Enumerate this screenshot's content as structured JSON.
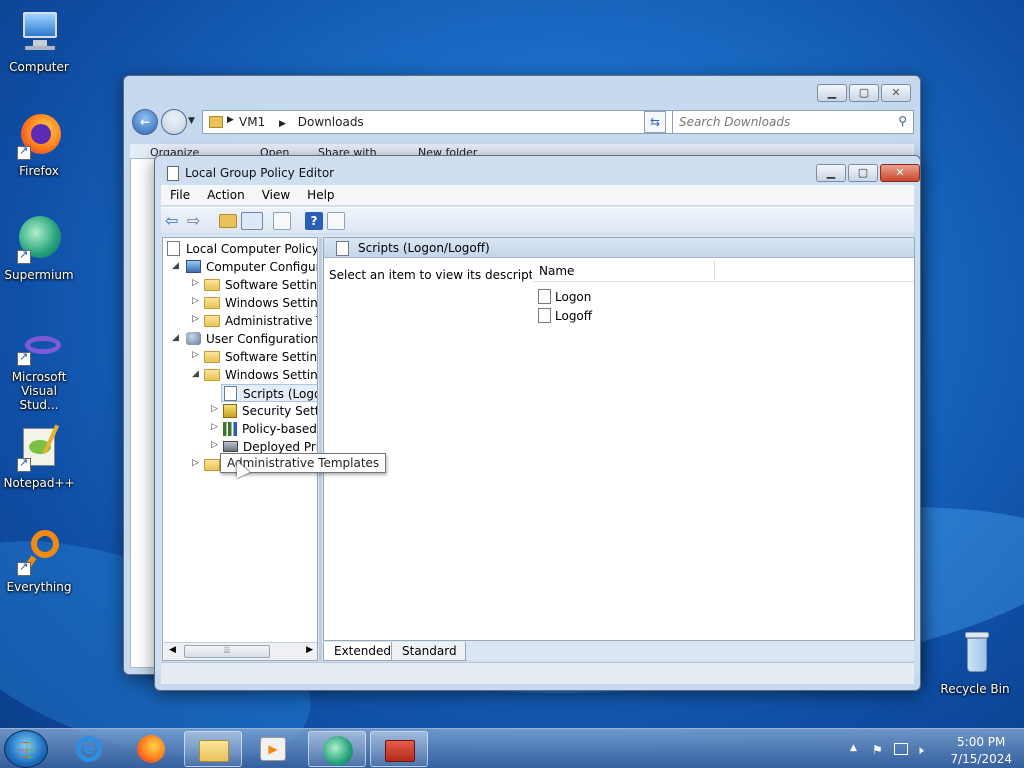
{
  "desktop": {
    "icons": [
      {
        "label": "Computer",
        "icon": "computer-icon"
      },
      {
        "label": "Firefox",
        "icon": "firefox-icon"
      },
      {
        "label": "Supermium",
        "icon": "supermium-icon"
      },
      {
        "label": "Microsoft Visual Stud...",
        "icon": "visual-studio-icon"
      },
      {
        "label": "Notepad++",
        "icon": "notepadpp-icon"
      },
      {
        "label": "Everything",
        "icon": "everything-icon"
      },
      {
        "label": "Recycle Bin",
        "icon": "recycle-bin-icon"
      }
    ]
  },
  "explorer": {
    "breadcrumb": [
      "VM1",
      "Downloads"
    ],
    "search_placeholder": "Search Downloads",
    "toolbar": [
      "Organize",
      "Open",
      "Share with",
      "New folder"
    ]
  },
  "gpedit": {
    "title": "Local Group Policy Editor",
    "menu": [
      "File",
      "Action",
      "View",
      "Help"
    ],
    "tree": [
      {
        "label": "Local Computer Policy",
        "level": 0
      },
      {
        "label": "Computer Configura",
        "level": 1
      },
      {
        "label": "Software Settings",
        "level": 2
      },
      {
        "label": "Windows Setting",
        "level": 2
      },
      {
        "label": "Administrative Te",
        "level": 2
      },
      {
        "label": "User Configuration",
        "level": 1
      },
      {
        "label": "Software Settings",
        "level": 2
      },
      {
        "label": "Windows Setting",
        "level": 2
      },
      {
        "label": "Scripts (Logon",
        "level": 3
      },
      {
        "label": "Security Settir",
        "level": 3
      },
      {
        "label": "Policy-based",
        "level": 3
      },
      {
        "label": "Deployed Prir",
        "level": 3
      },
      {
        "label": "Administrative Templates",
        "level": 2
      }
    ],
    "tooltip": "Administrative Templates",
    "right_header": "Scripts (Logon/Logoff)",
    "description": "Select an item to view its description.",
    "list": {
      "column": "Name",
      "items": [
        "Logon",
        "Logoff"
      ]
    },
    "tabs": [
      "Extended",
      "Standard"
    ]
  },
  "clock": {
    "time": "5:00 PM",
    "date": "7/15/2024"
  }
}
